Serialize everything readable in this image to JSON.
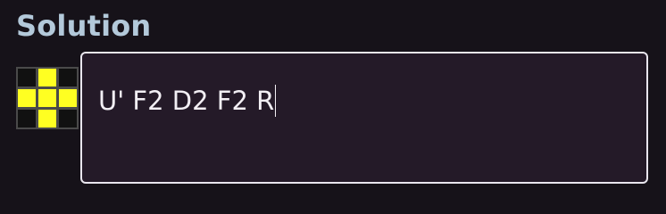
{
  "section": {
    "title": "Solution"
  },
  "face_icon": {
    "name": "cube-face-preview",
    "grid": [
      [
        "#111111",
        "#ffff22",
        "#111111"
      ],
      [
        "#ffff22",
        "#ffff22",
        "#ffff22"
      ],
      [
        "#111111",
        "#ffff22",
        "#111111"
      ]
    ]
  },
  "solution_input": {
    "value": "U' F2 D2 F2 R"
  },
  "colors": {
    "background": "#161219",
    "title": "#b3c9da",
    "input_background": "#241a28",
    "input_border": "#e9e6ee",
    "sticker_yellow": "#ffff22",
    "sticker_dark": "#111111"
  }
}
